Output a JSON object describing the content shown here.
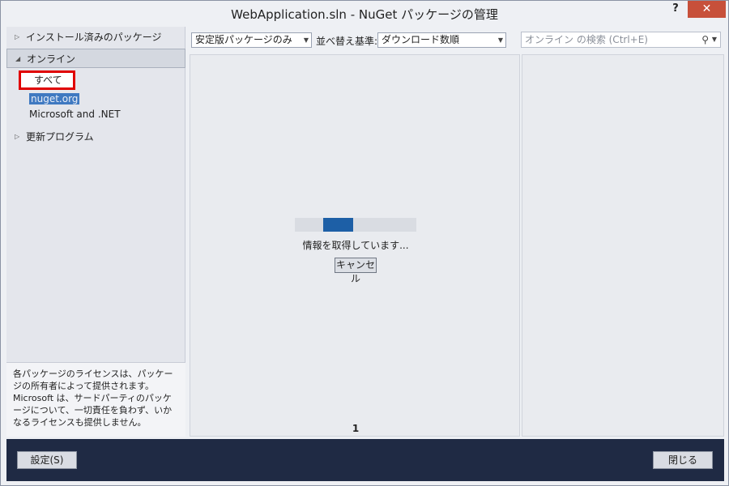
{
  "window": {
    "title": "WebApplication.sln - NuGet パッケージの管理",
    "help_label": "?",
    "close_label": "✕"
  },
  "sidebar": {
    "items": [
      {
        "label": "インストール済みのパッケージ",
        "arrow": "▷"
      },
      {
        "label": "オンライン",
        "arrow": "◢"
      },
      {
        "label": "更新プログラム",
        "arrow": "▷"
      }
    ],
    "sub_items": [
      {
        "label": "すべて"
      },
      {
        "label": "nuget.org"
      },
      {
        "label": "Microsoft and .NET"
      }
    ],
    "license_text": "各パッケージのライセンスは、パッケージの所有者によって提供されます。Microsoft は、サードパーティのパッケージについて、一切責任を負わず、いかなるライセンスも提供しません。"
  },
  "toolbar": {
    "filter_value": "安定版パッケージのみ",
    "sort_label": "並べ替え基準:",
    "sort_value": "ダウンロード数順",
    "search_placeholder": "オンライン の検索 (Ctrl+E)"
  },
  "main": {
    "progress_fraction": 0.25,
    "status_text": "情報を取得しています...",
    "cancel_label": "キャンセル",
    "page_number": "1"
  },
  "footer": {
    "settings_label": "設定(S)",
    "close_label": "閉じる"
  },
  "icons": {
    "search": "search-icon",
    "dropdown": "chevron-down-icon",
    "expand": "triangle-right-icon",
    "collapse": "triangle-down-icon"
  }
}
